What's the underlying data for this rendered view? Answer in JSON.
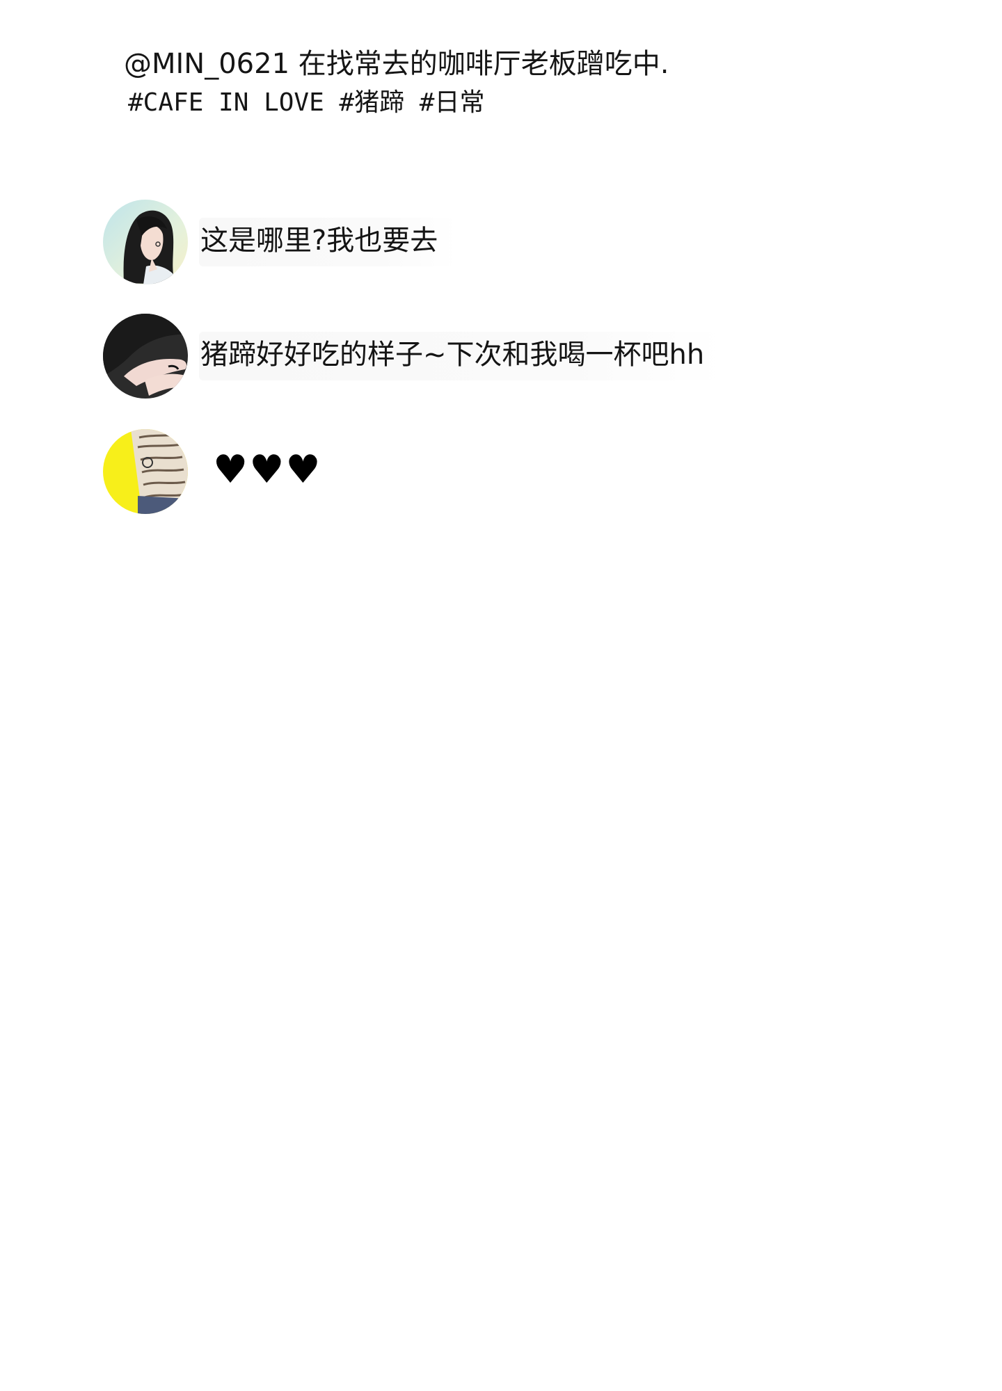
{
  "post": {
    "caption": "@MIN_0621 在找常去的咖啡厅老板蹭吃中.",
    "hashtags": "#CAFE IN LOVE #猪蹄 #日常"
  },
  "comments": [
    {
      "avatar_icon": "woman-long-hair-avatar",
      "text": "这是哪里?我也要去"
    },
    {
      "avatar_icon": "crossed-arms-avatar",
      "text": "猪蹄好好吃的样子~下次和我喝一杯吧hh"
    },
    {
      "avatar_icon": "patterned-shirt-yellow-avatar",
      "text": "♥♥♥"
    }
  ],
  "colors": {
    "background": "#ffffff",
    "text": "#141414",
    "bubble": "#f8f8f8",
    "avatar3_bg": "#f7ef1a"
  }
}
